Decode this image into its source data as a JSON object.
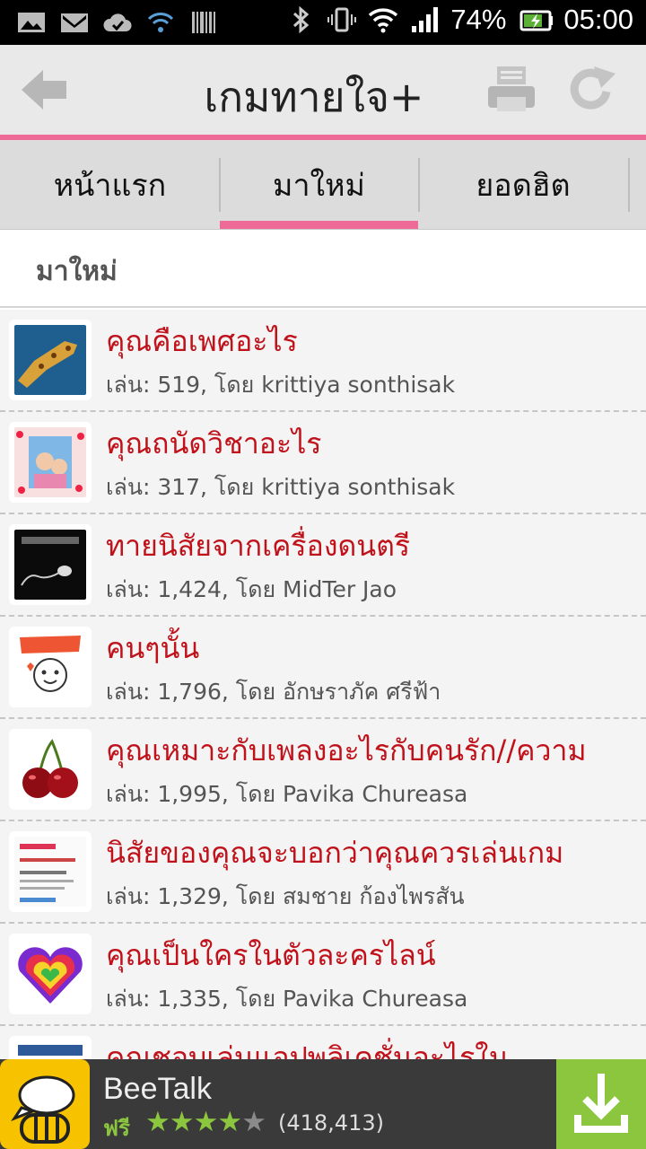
{
  "status_bar": {
    "battery": "74%",
    "time": "05:00"
  },
  "toolbar": {
    "title": "เกมทายใจ+"
  },
  "tabs": [
    {
      "label": "หน้าแรก"
    },
    {
      "label": "มาใหม่"
    },
    {
      "label": "ยอดฮิต"
    }
  ],
  "section": {
    "title": "มาใหม่"
  },
  "items": [
    {
      "title": "คุณคือเพศอะไร",
      "meta": "เล่น: 519, โดย krittiya sonthisak"
    },
    {
      "title": "คุณถนัดวิชาอะไร",
      "meta": "เล่น: 317, โดย krittiya sonthisak"
    },
    {
      "title": "ทายนิสัยจากเครื่องดนตรี",
      "meta": "เล่น: 1,424, โดย MidTer Jao"
    },
    {
      "title": "คนๆนั้น",
      "meta": "เล่น: 1,796, โดย อักษราภัค ศรีฟ้า"
    },
    {
      "title": "คุณเหมาะกับเพลงอะไรกับคนรัก//ความ",
      "meta": "เล่น: 1,995, โดย Pavika Chureasa"
    },
    {
      "title": "นิสัยของคุณจะบอกว่าคุณควรเล่นเกม",
      "meta": "เล่น: 1,329, โดย สมชาย ก้องไพรสัน"
    },
    {
      "title": "คุณเป็นใครในตัวละครไลน์",
      "meta": "เล่น: 1,335, โดย Pavika Chureasa"
    },
    {
      "title": "คุณชอบเล่นแอปพลิเคชั่นอะไรใน",
      "meta": ""
    }
  ],
  "ad": {
    "app_name": "BeeTalk",
    "price": "ฟรี",
    "rating": 4,
    "rating_max": 5,
    "review_count": "(418,413)"
  },
  "colors": {
    "accent_pink": "#ef6b97",
    "title_red": "#c0121b",
    "star_green": "#8cc63f",
    "download_green": "#8cc63f",
    "icon_yellow": "#f7c200"
  }
}
